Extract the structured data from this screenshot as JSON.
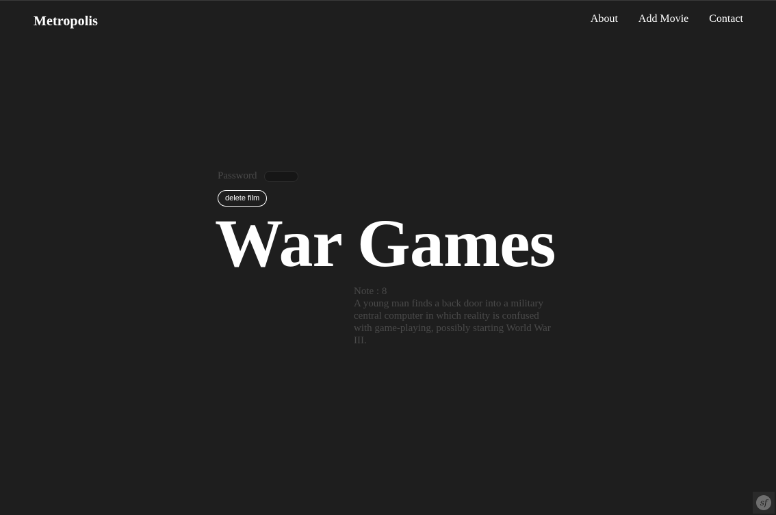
{
  "header": {
    "brand": "Metropolis",
    "nav": [
      {
        "label": "About"
      },
      {
        "label": "Add Movie"
      },
      {
        "label": "Contact"
      }
    ]
  },
  "delete_form": {
    "password_label": "Password",
    "password_value": "",
    "delete_button_label": "delete film"
  },
  "film": {
    "title": "War Games",
    "note": "Note : 8",
    "description": "A young man finds a back door into a military central computer in which reality is confused with game-playing, possibly starting World War III."
  },
  "toolbar_badge": {
    "label": "sf",
    "icon": "symfony-icon"
  }
}
